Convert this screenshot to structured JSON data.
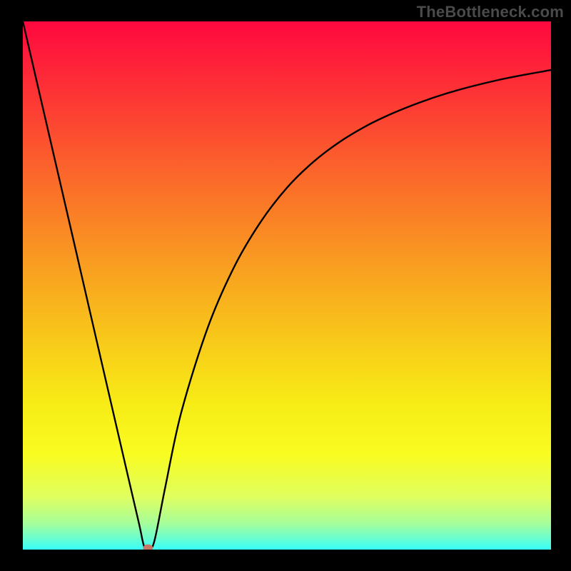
{
  "attribution": "TheBottleneck.com",
  "chart_data": {
    "type": "line",
    "title": "",
    "xlabel": "",
    "ylabel": "",
    "xlim": [
      0,
      100
    ],
    "ylim": [
      0,
      100
    ],
    "x": [
      0,
      5,
      10,
      15,
      20,
      22,
      23,
      24,
      25,
      27,
      30,
      35,
      40,
      45,
      50,
      55,
      60,
      65,
      70,
      75,
      80,
      85,
      90,
      95,
      100
    ],
    "values": [
      100,
      78.4,
      56.8,
      35.1,
      13.5,
      4.9,
      0.5,
      0.0,
      2.0,
      12.0,
      26.0,
      42.0,
      53.5,
      62.0,
      68.5,
      73.4,
      77.2,
      80.2,
      82.6,
      84.6,
      86.3,
      87.7,
      88.9,
      89.9,
      90.8
    ],
    "marker": {
      "x": 23.7,
      "y": 0.3,
      "color": "#c97766",
      "rx": 7,
      "ry": 5
    },
    "gradient_stops": [
      {
        "offset": 0.0,
        "color": "#fe083f"
      },
      {
        "offset": 0.15,
        "color": "#fd3834"
      },
      {
        "offset": 0.3,
        "color": "#fb6a2a"
      },
      {
        "offset": 0.45,
        "color": "#f99a21"
      },
      {
        "offset": 0.6,
        "color": "#f8c81a"
      },
      {
        "offset": 0.72,
        "color": "#f7eb16"
      },
      {
        "offset": 0.82,
        "color": "#f8fc21"
      },
      {
        "offset": 0.9,
        "color": "#e0fe5f"
      },
      {
        "offset": 0.95,
        "color": "#a6fe99"
      },
      {
        "offset": 0.98,
        "color": "#67fed2"
      },
      {
        "offset": 1.0,
        "color": "#36fefa"
      }
    ]
  }
}
